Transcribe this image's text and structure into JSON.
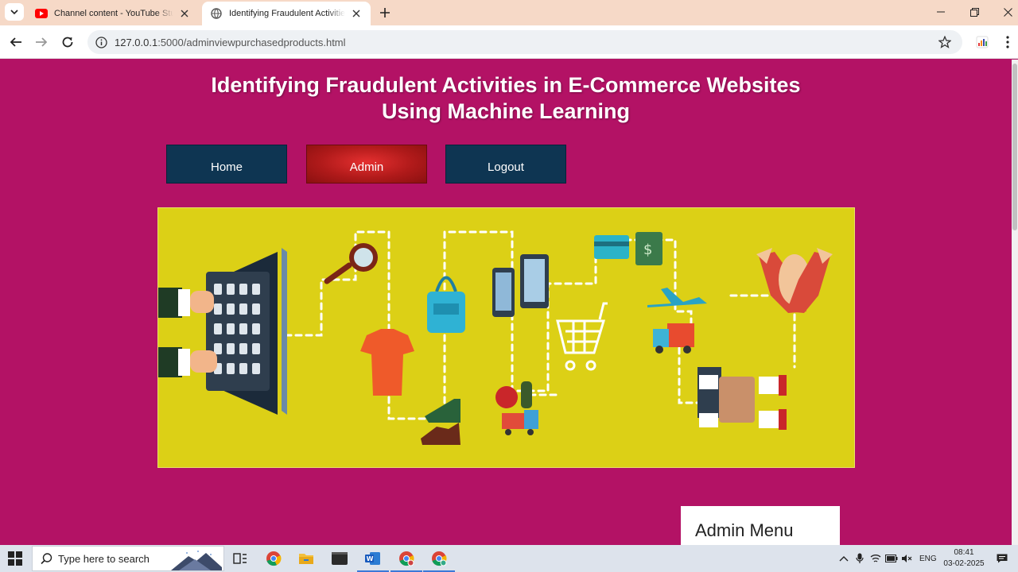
{
  "browser": {
    "tabs": [
      {
        "title": "Channel content - YouTube Studio",
        "active": false
      },
      {
        "title": "Identifying Fraudulent Activities in E-Commerce",
        "active": true
      }
    ],
    "url_host": "127.0.0.1",
    "url_rest": ":5000/adminviewpurchasedproducts.html"
  },
  "page": {
    "title": "Identifying Fraudulent Activities in E-Commerce Websites Using Machine Learning",
    "nav": [
      {
        "label": "Home",
        "active": false
      },
      {
        "label": "Admin",
        "active": true
      },
      {
        "label": "Logout",
        "active": false
      }
    ],
    "admin_menu": "Admin Menu"
  },
  "colors": {
    "page_bg": "#b31265",
    "nav_bg": "#0e3552",
    "nav_active": "#c62020",
    "banner_bg": "#dcd016"
  },
  "taskbar": {
    "search_placeholder": "Type here to search",
    "language": "ENG",
    "time": "08:41",
    "date": "03-02-2025"
  }
}
